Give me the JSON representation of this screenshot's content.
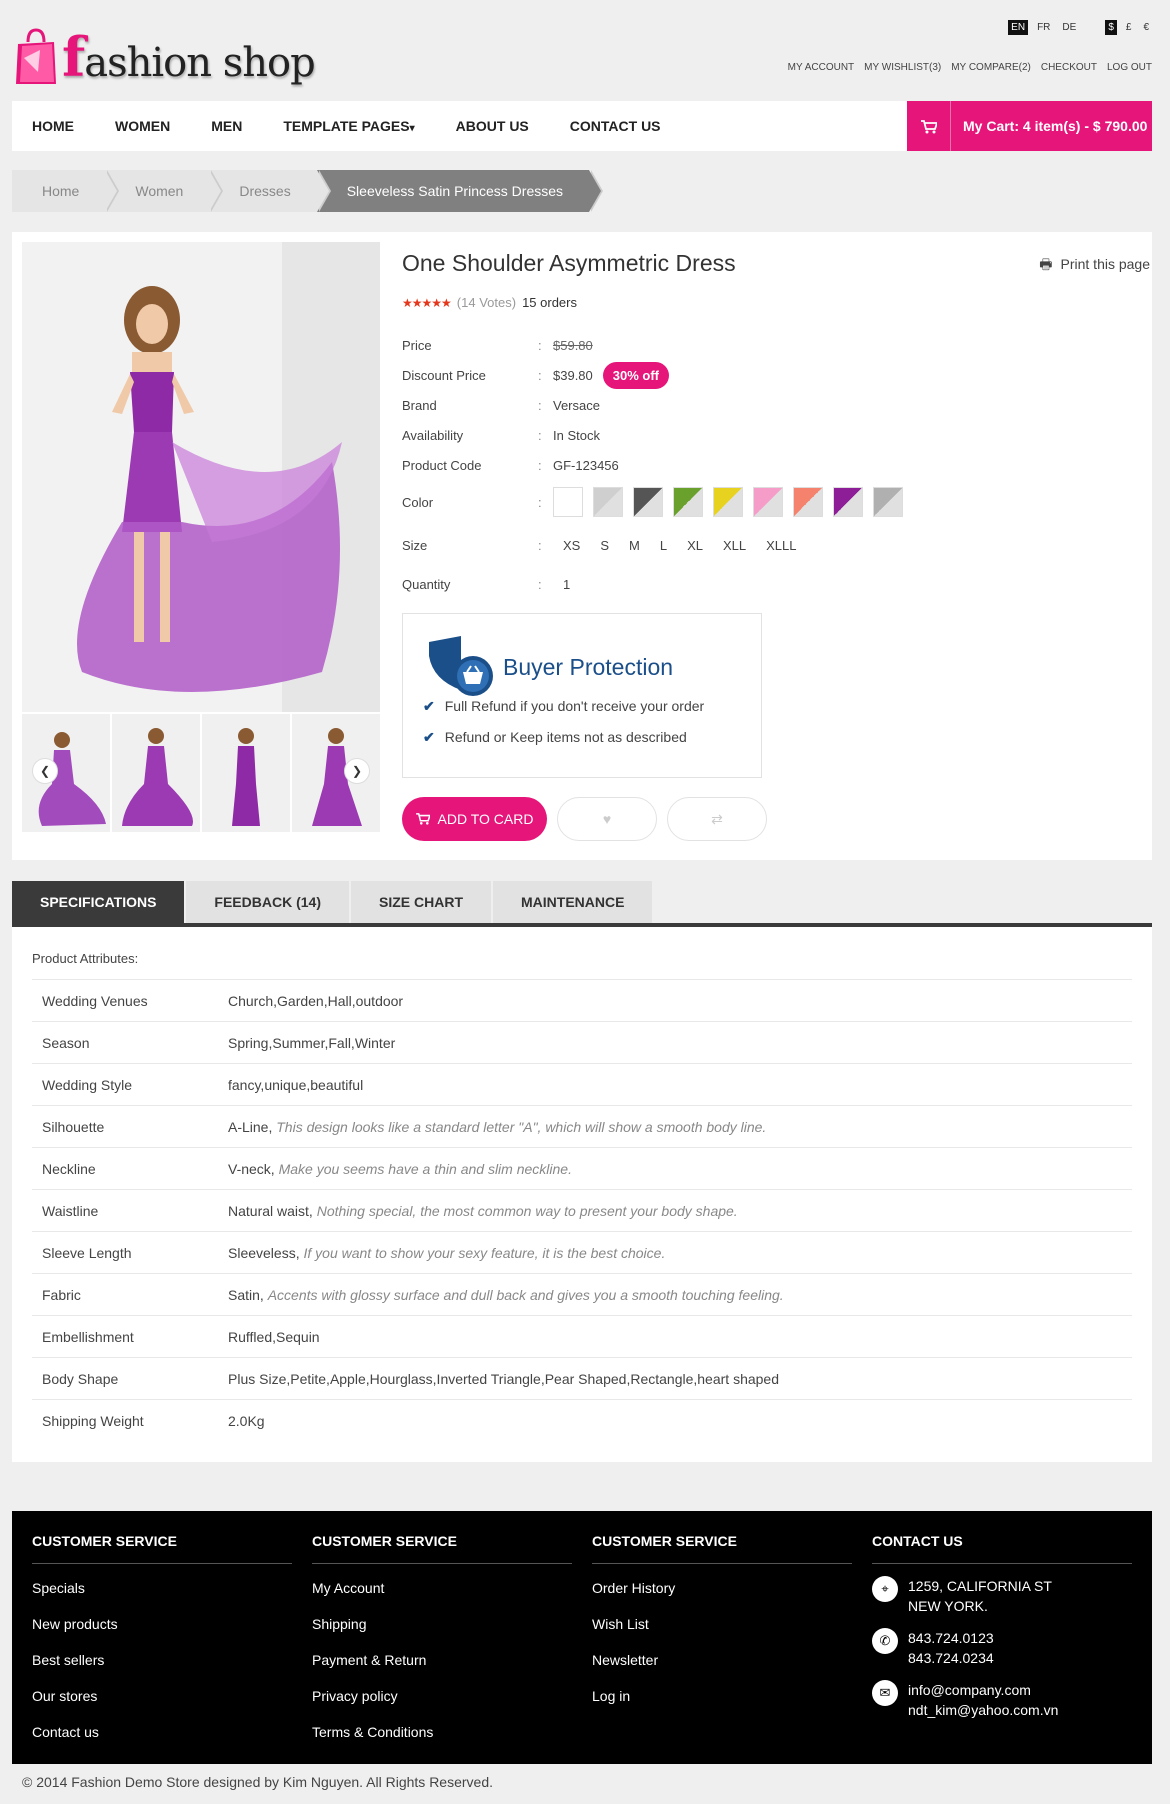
{
  "brand": {
    "logo_f": "f",
    "logo_rest": "ashion shop"
  },
  "languages": [
    "EN",
    "FR",
    "DE"
  ],
  "currencies": [
    "$",
    "£",
    "€"
  ],
  "top_links": [
    "MY ACCOUNT",
    "MY WISHLIST(3)",
    "MY COMPARE(2)",
    "CHECKOUT",
    "LOG OUT"
  ],
  "nav": {
    "items": [
      "HOME",
      "WOMEN",
      "MEN",
      "TEMPLATE PAGES",
      "ABOUT US",
      "CONTACT US"
    ],
    "dropdown_caret": "▾"
  },
  "cart": {
    "label": "My Cart: 4 item(s) - $ 790.00",
    "icon": "cart-icon"
  },
  "breadcrumb": [
    "Home",
    "Women",
    "Dresses",
    "Sleeveless Satin Princess Dresses"
  ],
  "product": {
    "title": "One Shoulder Asymmetric Dress",
    "print": "Print this page",
    "rating_stars": 4.5,
    "votes": "(14 Votes)",
    "orders": "15 orders",
    "price_label": "Price",
    "price": "$59.80",
    "discount_label": "Discount Price",
    "discount_price": "$39.80",
    "discount_badge": "30% off",
    "brand_label": "Brand",
    "brand": "Versace",
    "availability_label": "Availability",
    "availability": "In Stock",
    "code_label": "Product Code",
    "code": "GF-123456",
    "color_label": "Color",
    "colors": [
      "#ffffff",
      "#cfcfcf",
      "#555555",
      "#6aa12d",
      "#e6d21f",
      "#f59dc8",
      "#f5826c",
      "#8e1d98",
      "#b0b0b0"
    ],
    "size_label": "Size",
    "sizes": [
      "XS",
      "S",
      "M",
      "L",
      "XL",
      "XLL",
      "XLLL"
    ],
    "quantity_label": "Quantity",
    "quantity": "1",
    "separator": ":"
  },
  "buyer_protection": {
    "title": "Buyer Protection",
    "lines": [
      "Full Refund if you don't receive your order",
      "Refund or Keep items not as described"
    ]
  },
  "actions": {
    "add_to_cart": "ADD TO CARD"
  },
  "tabs": [
    "SPECIFICATIONS",
    "FEEDBACK (14)",
    "SIZE CHART",
    "MAINTENANCE"
  ],
  "specs": {
    "heading": "Product Attributes:",
    "rows": [
      {
        "k": "Wedding Venues",
        "v": "Church,Garden,Hall,outdoor",
        "note": ""
      },
      {
        "k": "Season",
        "v": "Spring,Summer,Fall,Winter",
        "note": ""
      },
      {
        "k": "Wedding Style",
        "v": "fancy,unique,beautiful",
        "note": ""
      },
      {
        "k": "Silhouette",
        "v": "A-Line,",
        "note": "This design looks like a standard letter \"A\", which will show a smooth body line."
      },
      {
        "k": "Neckline",
        "v": "V-neck,",
        "note": "Make you seems have a thin and slim neckline."
      },
      {
        "k": "Waistline",
        "v": "Natural waist,",
        "note": "Nothing special, the most common way to present your body shape."
      },
      {
        "k": "Sleeve Length",
        "v": "Sleeveless,",
        "note": "If you want to show your sexy feature, it is the best choice."
      },
      {
        "k": "Fabric",
        "v": "Satin,",
        "note": "Accents with glossy surface and dull back and gives you a smooth touching feeling."
      },
      {
        "k": "Embellishment",
        "v": "Ruffled,Sequin",
        "note": ""
      },
      {
        "k": "Body Shape",
        "v": "Plus Size,Petite,Apple,Hourglass,Inverted Triangle,Pear Shaped,Rectangle,heart shaped",
        "note": ""
      },
      {
        "k": "Shipping Weight",
        "v": "2.0Kg",
        "note": ""
      }
    ]
  },
  "footer": {
    "cols": [
      {
        "title": "CUSTOMER SERVICE",
        "links": [
          "Specials",
          "New products",
          "Best sellers",
          "Our stores",
          "Contact us"
        ]
      },
      {
        "title": "CUSTOMER SERVICE",
        "links": [
          "My Account",
          "Shipping",
          "Payment & Return",
          "Privacy policy",
          "Terms & Conditions"
        ]
      },
      {
        "title": "CUSTOMER SERVICE",
        "links": [
          "Order History",
          "Wish List",
          "Newsletter",
          "Log in"
        ]
      }
    ],
    "contact": {
      "title": "CONTACT US",
      "address": [
        "1259, CALIFORNIA ST",
        "NEW YORK."
      ],
      "phones": [
        "843.724.0123",
        "843.724.0234"
      ],
      "emails": [
        "info@company.com",
        "ndt_kim@yahoo.com.vn"
      ]
    },
    "copyright": "© 2014 Fashion Demo Store designed by Kim Nguyen. All Rights Reserved."
  }
}
